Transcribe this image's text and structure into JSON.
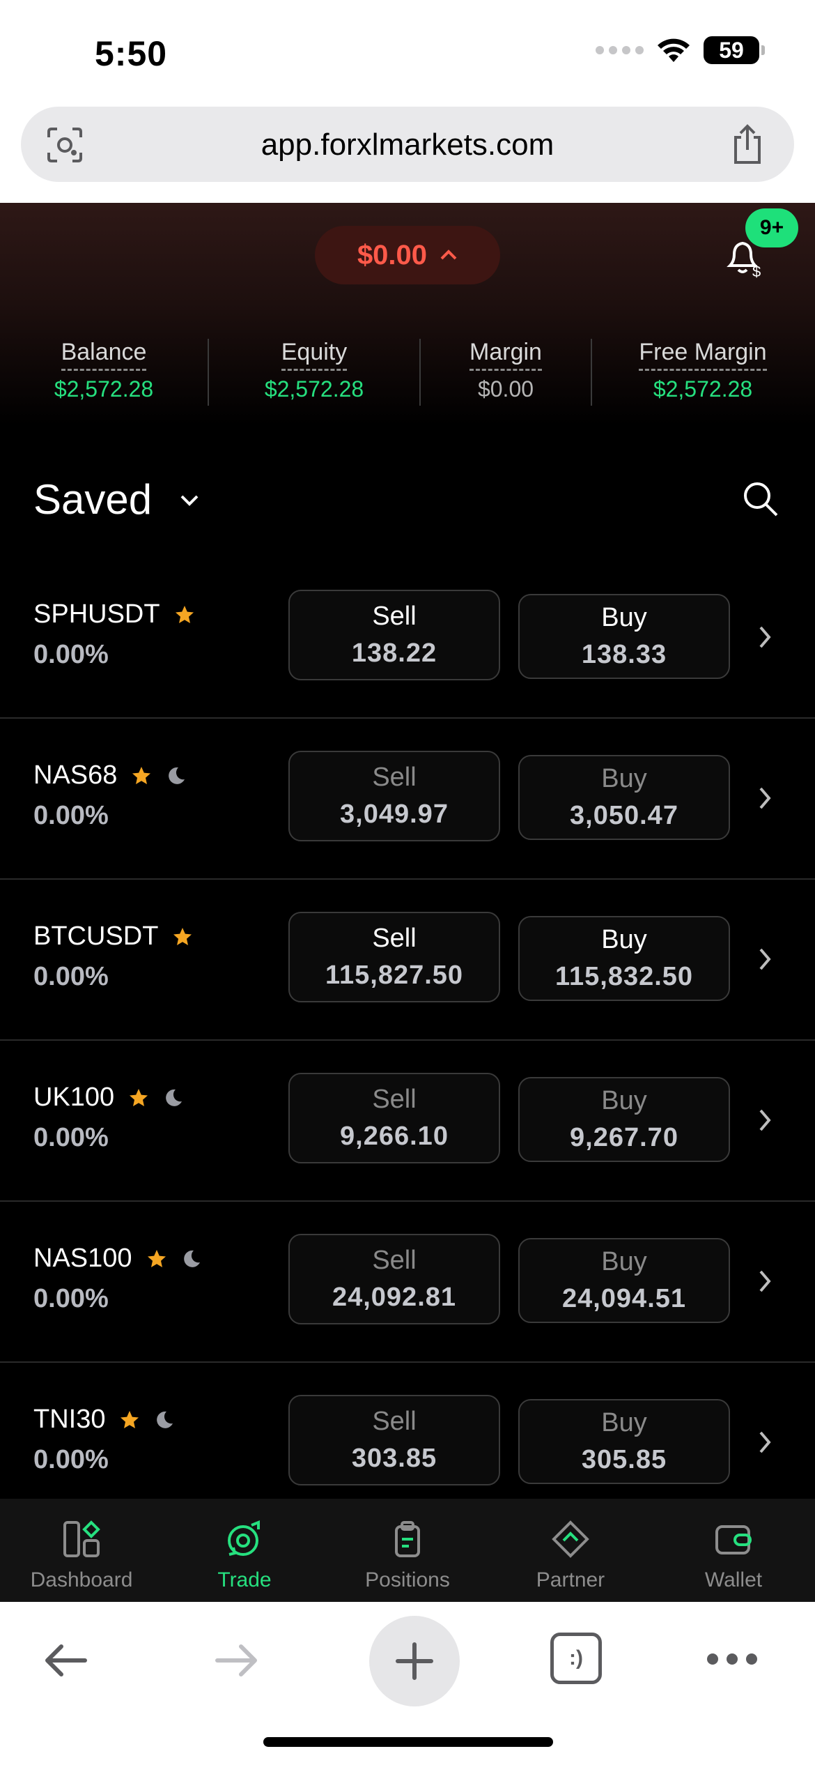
{
  "status_bar": {
    "time": "5:50",
    "battery": "59"
  },
  "browser": {
    "url": "app.forxlmarkets.com",
    "tabs_label": ":)"
  },
  "header": {
    "pnl": "$0.00",
    "notif_badge": "9+"
  },
  "account_stats": [
    {
      "label": "Balance",
      "value": "$2,572.28",
      "color": "#26e07f"
    },
    {
      "label": "Equity",
      "value": "$2,572.28",
      "color": "#26e07f"
    },
    {
      "label": "Margin",
      "value": "$0.00",
      "color": "#b5b5b5"
    },
    {
      "label": "Free Margin",
      "value": "$2,572.28",
      "color": "#26e07f"
    }
  ],
  "watchlist": {
    "title": "Saved",
    "rows": [
      {
        "symbol": "SPHUSDT",
        "change": "0.00%",
        "sell_label": "Sell",
        "sell": "138.22",
        "buy_label": "Buy",
        "buy": "138.33",
        "market_closed": false
      },
      {
        "symbol": "NAS68",
        "change": "0.00%",
        "sell_label": "Sell",
        "sell": "3,049.97",
        "buy_label": "Buy",
        "buy": "3,050.47",
        "market_closed": true
      },
      {
        "symbol": "BTCUSDT",
        "change": "0.00%",
        "sell_label": "Sell",
        "sell": "115,827.50",
        "buy_label": "Buy",
        "buy": "115,832.50",
        "market_closed": false
      },
      {
        "symbol": "UK100",
        "change": "0.00%",
        "sell_label": "Sell",
        "sell": "9,266.10",
        "buy_label": "Buy",
        "buy": "9,267.70",
        "market_closed": true
      },
      {
        "symbol": "NAS100",
        "change": "0.00%",
        "sell_label": "Sell",
        "sell": "24,092.81",
        "buy_label": "Buy",
        "buy": "24,094.51",
        "market_closed": true
      },
      {
        "symbol": "TNI30",
        "change": "0.00%",
        "sell_label": "Sell",
        "sell": "303.85",
        "buy_label": "Buy",
        "buy": "305.85",
        "market_closed": true
      }
    ]
  },
  "bottom_nav": [
    {
      "label": "Dashboard",
      "icon": "dashboard-icon",
      "active": false
    },
    {
      "label": "Trade",
      "icon": "trade-icon",
      "active": true
    },
    {
      "label": "Positions",
      "icon": "positions-icon",
      "active": false
    },
    {
      "label": "Partner",
      "icon": "partner-icon",
      "active": false
    },
    {
      "label": "Wallet",
      "icon": "wallet-icon",
      "active": false
    }
  ],
  "colors": {
    "accent_green": "#26e07f",
    "loss_red": "#ff5a4a",
    "star": "#f5a623"
  }
}
